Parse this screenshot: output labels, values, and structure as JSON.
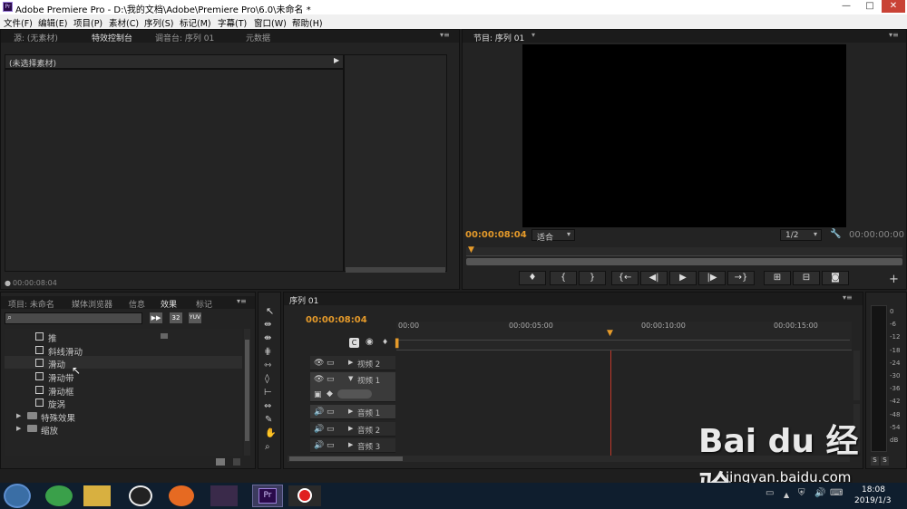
{
  "window": {
    "title": "Adobe Premiere Pro - D:\\我的文档\\Adobe\\Premiere Pro\\6.0\\未命名 *",
    "logo": "Pr"
  },
  "menu": [
    "文件(F)",
    "编辑(E)",
    "项目(P)",
    "素材(C)",
    "序列(S)",
    "标记(M)",
    "字幕(T)",
    "窗口(W)",
    "帮助(H)"
  ],
  "source_panel": {
    "tabs": [
      "源: (无素材)",
      "特效控制台",
      "调音台: 序列 01",
      "元数据"
    ],
    "no_clip": "(未选择素材)",
    "timecode": "00:00:08:04"
  },
  "program_panel": {
    "tab": "节目: 序列 01",
    "timecode": "00:00:08:04",
    "fit": "适合",
    "resolution": "1/2",
    "duration": "00:00:00:00"
  },
  "project_panel": {
    "tabs": [
      "项目: 未命名",
      "媒体浏览器",
      "信息",
      "效果",
      "标记"
    ],
    "badges": [
      "32",
      "YUV"
    ],
    "items": [
      {
        "label": "推"
      },
      {
        "label": "斜线滑动"
      },
      {
        "label": "滑动"
      },
      {
        "label": "滑动带"
      },
      {
        "label": "滑动框"
      },
      {
        "label": "旋涡"
      }
    ],
    "folders": [
      "特殊效果",
      "缩放"
    ]
  },
  "timeline": {
    "tab": "序列 01",
    "timecode": "00:00:08:04",
    "ruler": [
      "00:00",
      "00:00:05:00",
      "00:00:10:00",
      "00:00:15:00"
    ],
    "tracks": [
      "视频 2",
      "视频 1",
      "音频 1",
      "音频 2",
      "音频 3"
    ]
  },
  "meter": {
    "scale": [
      "0",
      "-6",
      "-12",
      "-18",
      "-24",
      "-30",
      "-36",
      "-42",
      "-48",
      "-54",
      "dB"
    ],
    "solo": [
      "S",
      "S"
    ]
  },
  "taskbar": {
    "time": "18:08",
    "date": "2019/1/3",
    "pr_label": "Pr"
  },
  "watermark": {
    "brand": "Bai du 经验",
    "url": "jingyan.baidu.com"
  }
}
